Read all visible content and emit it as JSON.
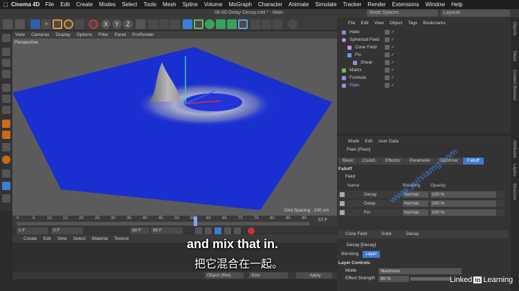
{
  "mac_menu": {
    "app": "Cinema 4D",
    "items": [
      "File",
      "Edit",
      "Create",
      "Modes",
      "Select",
      "Tools",
      "Mesh",
      "Spline",
      "Volume",
      "MoGraph",
      "Character",
      "Animate",
      "Simulate",
      "Tracker",
      "Render",
      "Extensions",
      "Window",
      "Help"
    ]
  },
  "title_bar": {
    "document": "06-05-Delay-Decay.c4d * - Main",
    "node_spaces": "Node Spaces",
    "layouts": "Layouts"
  },
  "toolbar": {
    "axis_icons": [
      "X",
      "Y",
      "Z"
    ]
  },
  "viewport": {
    "menu": [
      "View",
      "Cameras",
      "Display",
      "Options",
      "Filter",
      "Panel",
      "ProRender"
    ],
    "label": "Perspective",
    "grid_spacing": "Grid Spacing : 100 cm",
    "plane_color": "#1a2fd0"
  },
  "timeline": {
    "ticks": [
      "0",
      "5",
      "10",
      "15",
      "20",
      "25",
      "30",
      "35",
      "40",
      "45",
      "50",
      "55",
      "60",
      "65",
      "70",
      "75",
      "80",
      "85",
      "90"
    ],
    "current_frame": "57 F",
    "start": "0 F",
    "current": "0 F",
    "end_a": "90 F",
    "end_b": "90 F"
  },
  "material_menu": [
    "Create",
    "Edit",
    "View",
    "Select",
    "Material",
    "Texture"
  ],
  "coord_bar": {
    "mode": "Object (Rel)",
    "size": "Size",
    "apply": "Apply"
  },
  "object_manager": {
    "menu": [
      "File",
      "Edit",
      "View",
      "Object",
      "Tags",
      "Bookmarks"
    ],
    "objects": [
      {
        "name": "Helix",
        "indent": 0,
        "color": "#8a8ad8"
      },
      {
        "name": "Spherical Field",
        "indent": 0,
        "color": "#c78be0"
      },
      {
        "name": "Cone Field",
        "indent": 1,
        "color": "#c78be0"
      },
      {
        "name": "Fin",
        "indent": 1,
        "color": "#60a0e0"
      },
      {
        "name": "Shear",
        "indent": 2,
        "color": "#9090e0"
      },
      {
        "name": "Matrix",
        "indent": 0,
        "color": "#5fc05f"
      },
      {
        "name": "Formula",
        "indent": 0,
        "color": "#9090e0"
      },
      {
        "name": "Plain",
        "indent": 0,
        "color": "#9090e0"
      }
    ]
  },
  "attributes": {
    "menu": [
      "Mode",
      "Edit",
      "User Data"
    ],
    "object": "Plain [Plain]",
    "tabs": [
      "Basic",
      "Coord.",
      "Effector",
      "Parameter",
      "Deformer",
      "Falloff"
    ],
    "active_tab": "Falloff",
    "section": "Falloff",
    "field_label": "Field",
    "headers": {
      "name": "Name",
      "blending": "Blending",
      "opacity": "Opacity"
    },
    "field_rows": [
      {
        "name": "Decay",
        "blending": "Normal",
        "opacity": "100 %"
      },
      {
        "name": "Delay",
        "blending": "Normal",
        "opacity": "100 %"
      },
      {
        "name": "Fin",
        "blending": "Normal",
        "opacity": "100 %"
      }
    ],
    "field_buttons": [
      "Cone Field",
      "Solid",
      "Decay"
    ],
    "decay_title": "Decay [Decay]",
    "blend_tabs": [
      "Blending",
      "Layer"
    ],
    "active_blend_tab": "Layer",
    "layer_controls": "Layer Controls",
    "mode_label": "Mode",
    "mode_value": "Maximum",
    "strength_label": "Effect Strength",
    "strength_value": "80 %"
  },
  "side_tabs": [
    "Objects",
    "Takes",
    "Content Browser",
    "Attributes",
    "Layers",
    "Structure"
  ],
  "subtitles": {
    "en": "and mix that in.",
    "zh": "把它混合在一起。"
  },
  "watermark": "www.yuisiamg.com",
  "branding": {
    "linked": "Linked",
    "in": "in",
    "learning": "Learning"
  }
}
